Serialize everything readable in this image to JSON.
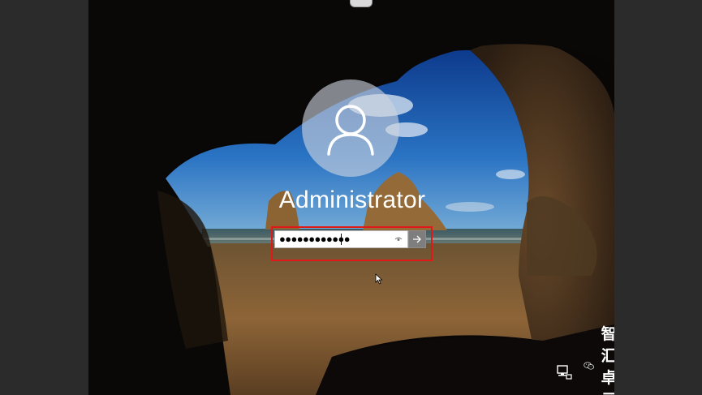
{
  "login": {
    "username": "Administrator",
    "password_masked": "●●●●●●●●●●●●"
  },
  "icons": {
    "avatar": "user-silhouette-icon",
    "reveal": "eye-icon",
    "submit": "arrow-right-icon",
    "network": "network-icon",
    "pointer": "mouse-cursor-icon",
    "watermark": "wechat-icon"
  },
  "watermark": {
    "text": "智汇卓云"
  },
  "colors": {
    "highlight": "#e01818",
    "avatar_circle": "#cdd4de",
    "submit_button": "#7e7e7e"
  }
}
